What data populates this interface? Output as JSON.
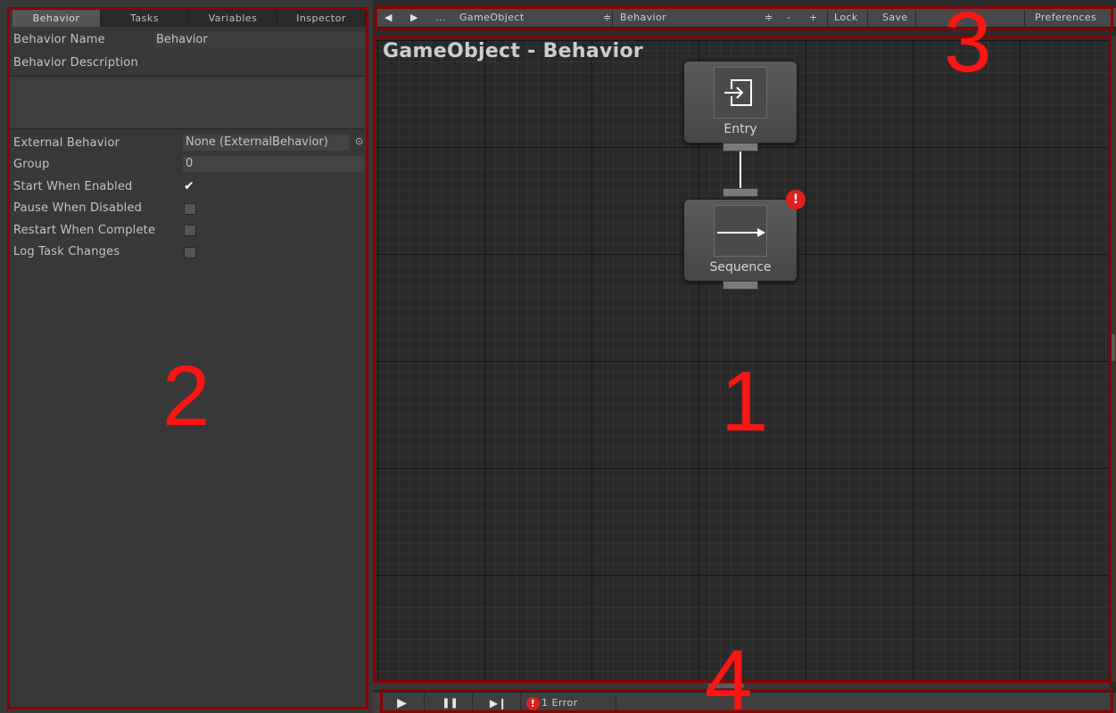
{
  "tabs": [
    {
      "label": "Behavior",
      "active": true
    },
    {
      "label": "Tasks",
      "active": false
    },
    {
      "label": "Variables",
      "active": false
    },
    {
      "label": "Inspector",
      "active": false
    }
  ],
  "inspector": {
    "behavior_name_label": "Behavior Name",
    "behavior_name_value": "Behavior",
    "behavior_description_label": "Behavior Description",
    "behavior_description_value": "",
    "external_behavior_label": "External Behavior",
    "external_behavior_value": "None (ExternalBehavior)",
    "group_label": "Group",
    "group_value": "0",
    "start_when_enabled_label": "Start When Enabled",
    "start_when_enabled": true,
    "pause_when_disabled_label": "Pause When Disabled",
    "pause_when_disabled": false,
    "restart_when_complete_label": "Restart When Complete",
    "restart_when_complete": false,
    "log_task_changes_label": "Log Task Changes",
    "log_task_changes": false,
    "object_picker_glyph": "⊙",
    "checkmark_glyph": "✔"
  },
  "toolbar": {
    "back_glyph": "◀",
    "forward_glyph": "▶",
    "ellipsis": "...",
    "gameobject_selector": "GameObject",
    "behavior_selector": "Behavior",
    "dropdown_glyph": "≑",
    "minus_label": "-",
    "plus_label": "+",
    "lock_label": "Lock",
    "save_label": "Save",
    "preferences_label": "Preferences"
  },
  "graph": {
    "title": "GameObject - Behavior",
    "nodes": [
      {
        "label": "Entry",
        "icon": "entry-icon",
        "has_error": false
      },
      {
        "label": "Sequence",
        "icon": "sequence-arrow-icon",
        "has_error": true
      }
    ],
    "error_badge_glyph": "!"
  },
  "debug_bar": {
    "play_glyph": "▶",
    "pause_glyph": "❚❚",
    "step_glyph": "▶❙",
    "error_glyph": "!",
    "error_text": "1 Error"
  },
  "annotations": {
    "one": "1",
    "two": "2",
    "three": "3",
    "four": "4",
    "color": "#ff1414"
  },
  "colors": {
    "panel_bg": "#383838",
    "graph_bg": "#2a2a2a",
    "error_red": "#e02020",
    "annotation_border": "#8b0000"
  }
}
